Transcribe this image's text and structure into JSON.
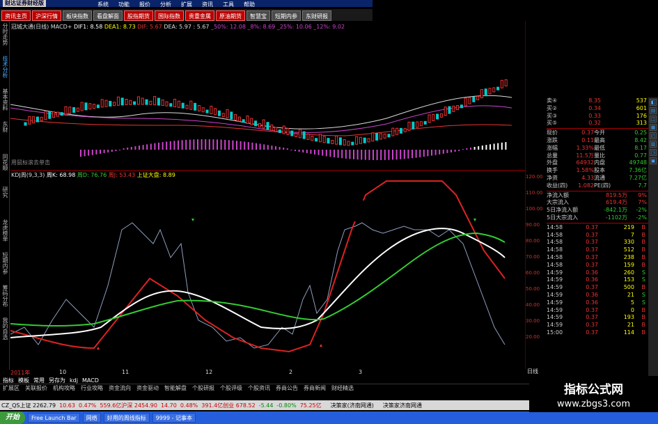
{
  "app": {
    "logo": "财达证券财经版",
    "menu": [
      "系统",
      "功能",
      "报价",
      "分析",
      "扩展",
      "资讯",
      "工具",
      "帮助"
    ]
  },
  "tabs": [
    {
      "label": "资讯主页",
      "style": "red"
    },
    {
      "label": "沪深行情",
      "style": "red"
    },
    {
      "label": "板块指数",
      "style": "normal"
    },
    {
      "label": "看盘解面",
      "style": "normal"
    },
    {
      "label": "股指期货",
      "style": "red"
    },
    {
      "label": "国际指数",
      "style": "red"
    },
    {
      "label": "贵重金属",
      "style": "red"
    },
    {
      "label": "原油期货",
      "style": "red"
    },
    {
      "label": "智慧宝",
      "style": "normal"
    },
    {
      "label": "短期内参",
      "style": "normal"
    },
    {
      "label": "东财研报",
      "style": "normal"
    }
  ],
  "left_tabs": [
    "分时走势",
    "技术分析",
    "基本资料",
    "东财",
    "同花顺",
    "研究",
    "龙虎榜单",
    "短期内参",
    "筹码分布",
    "我的自选"
  ],
  "main_info": {
    "name": "冠城大通(日线) MACD+",
    "dif1": "DIF1: 8.58",
    "dea1": "DEA1: 8.73",
    "dif": "DIF: 5.67",
    "dea": "DEA: 5.97 : 5.67",
    "pct": "_50%: 12.08  _8%: 8.69  _25%: 10.06  _12%: 9.02"
  },
  "hint": "用鼠标滚去单击",
  "kdj_info": {
    "name": "KDJ周(9,3,3)",
    "k": "周K: 68.98",
    "d": "周D: 76.76",
    "j": "周J: 53.43",
    "sz": "上证大盘: 8.89"
  },
  "y_axis_kdj": [
    "120.00",
    "110.00",
    "100.00",
    "90.00",
    "80.00",
    "70.00",
    "60.00",
    "50.00",
    "40.00",
    "30.00",
    "20.00"
  ],
  "x_axis": [
    "2011年",
    "10",
    "11",
    "12",
    "2",
    "3"
  ],
  "quote": {
    "asks": [
      {
        "label": "卖④",
        "price": "8.35",
        "vol": "537"
      },
      {
        "label": "买②",
        "price": "0.34",
        "vol": "601"
      },
      {
        "label": "买③",
        "price": "0.33",
        "vol": "176"
      },
      {
        "label": "买⑤",
        "price": "0.32",
        "vol": "313"
      }
    ],
    "fields": [
      {
        "l1": "现价",
        "v1": "0.37",
        "l2": "今开",
        "v2": "0.25"
      },
      {
        "l1": "涨跌",
        "v1": "0.11",
        "l2": "最高",
        "v2": "8.42"
      },
      {
        "l1": "涨幅",
        "v1": "1.33%",
        "l2": "最低",
        "v2": "8.17"
      },
      {
        "l1": "总量",
        "v1": "11.5万",
        "l2": "量比",
        "v2": "0.77"
      },
      {
        "l1": "外盘",
        "v1": "64932",
        "l2": "内盘",
        "v2": "49748"
      },
      {
        "l1": "换手",
        "v1": "1.58%",
        "l2": "股本",
        "v2": "7.36亿"
      },
      {
        "l1": "净资",
        "v1": "4.33",
        "l2": "流通",
        "v2": "7.27亿"
      },
      {
        "l1": "收益(四)",
        "v1": "1.082",
        "l2": "PE(四)",
        "v2": "7.7"
      }
    ],
    "flows": [
      {
        "label": "净流入额",
        "value": "819.5万",
        "pct": "9%"
      },
      {
        "label": "大宗流入",
        "value": "619.4万",
        "pct": "7%"
      },
      {
        "label": "5日净流入额",
        "value": "-842.1万",
        "pct": "-2%"
      },
      {
        "label": "5日大宗流入",
        "value": "-1102万",
        "pct": "-2%"
      }
    ],
    "ticks": [
      {
        "t": "14:58",
        "p": "0.37",
        "v": "219",
        "s": "B"
      },
      {
        "t": "14:58",
        "p": "0.37",
        "v": "7",
        "s": "B"
      },
      {
        "t": "14:58",
        "p": "0.37",
        "v": "330",
        "s": "B"
      },
      {
        "t": "14:58",
        "p": "0.37",
        "v": "512",
        "s": "B"
      },
      {
        "t": "14:58",
        "p": "0.37",
        "v": "238",
        "s": "B"
      },
      {
        "t": "14:58",
        "p": "0.37",
        "v": "159",
        "s": "B"
      },
      {
        "t": "14:59",
        "p": "0.36",
        "v": "260",
        "s": "S"
      },
      {
        "t": "14:59",
        "p": "0.36",
        "v": "153",
        "s": "S"
      },
      {
        "t": "14:59",
        "p": "0.37",
        "v": "500",
        "s": "B"
      },
      {
        "t": "14:59",
        "p": "0.36",
        "v": "21",
        "s": "S"
      },
      {
        "t": "14:59",
        "p": "0.36",
        "v": "5",
        "s": "S"
      },
      {
        "t": "14:59",
        "p": "0.37",
        "v": "0",
        "s": "B"
      },
      {
        "t": "14:59",
        "p": "0.37",
        "v": "193",
        "s": "B"
      },
      {
        "t": "14:59",
        "p": "0.37",
        "v": "21",
        "s": "B"
      },
      {
        "t": "15:00",
        "p": "0.37",
        "v": "114",
        "s": "B"
      }
    ]
  },
  "toolbar": [
    "指标",
    "模板",
    "常用",
    "另存为",
    "kdj",
    "MACD"
  ],
  "bottom_menu": [
    "扩展区",
    "关联报价",
    "机构攻略",
    "行业攻略",
    "资金流向",
    "资金驱动",
    "智能解盘",
    "个股研报",
    "个股评级",
    "个股资讯",
    "券商公告",
    "券商新闻",
    "财经精选"
  ],
  "ticker": {
    "items": [
      "CZ_QS上证 2262.79",
      "10.63",
      "0.47%",
      "559.6亿沪深 2454.90",
      "14.70",
      "0.48%",
      "391.4亿创业 678.52",
      "-5.44",
      "-0.80%",
      "75.25亿"
    ],
    "right": [
      "决策家(济南网通)",
      "决策家济南网通"
    ]
  },
  "taskbar": {
    "start": "开始",
    "items": [
      "Free Launch Bar",
      "网络",
      "好用的周线指标",
      "9999 - 记事本"
    ]
  },
  "watermark": {
    "line1": "指标公式网",
    "line2": "www.zbgs3.com"
  },
  "y_label_right": "日线",
  "colors": {
    "up": "#ff3333",
    "down": "#33ff33",
    "k": "#ffffff",
    "d": "#33cc33",
    "j": "#8fa0c0",
    "red": "#e02020"
  }
}
